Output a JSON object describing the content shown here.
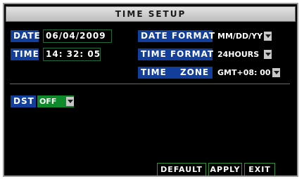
{
  "title": "TIME SETUP",
  "date": {
    "label": "DATE",
    "value": "06/04/2009"
  },
  "time": {
    "label": "TIME",
    "value": "14: 32: 05"
  },
  "date_format": {
    "label": "DATE FORMAT",
    "value": "MM/DD/YY"
  },
  "time_format": {
    "label": "TIME FORMAT",
    "value": "24HOURS"
  },
  "time_zone": {
    "label": "TIME ZONE",
    "value": "GMT+08: 00"
  },
  "dst": {
    "label": "DST",
    "value": "OFF"
  },
  "buttons": {
    "default": "DEFAULT",
    "apply": "APPLY",
    "exit": "EXIT"
  },
  "colors": {
    "label_bg": "#123f9c",
    "dst_bg": "#0f8a2a",
    "border_green": "#2f8f3d",
    "title_bg": "#d0d0d0"
  },
  "icons": [
    "chevron-down-icon"
  ]
}
